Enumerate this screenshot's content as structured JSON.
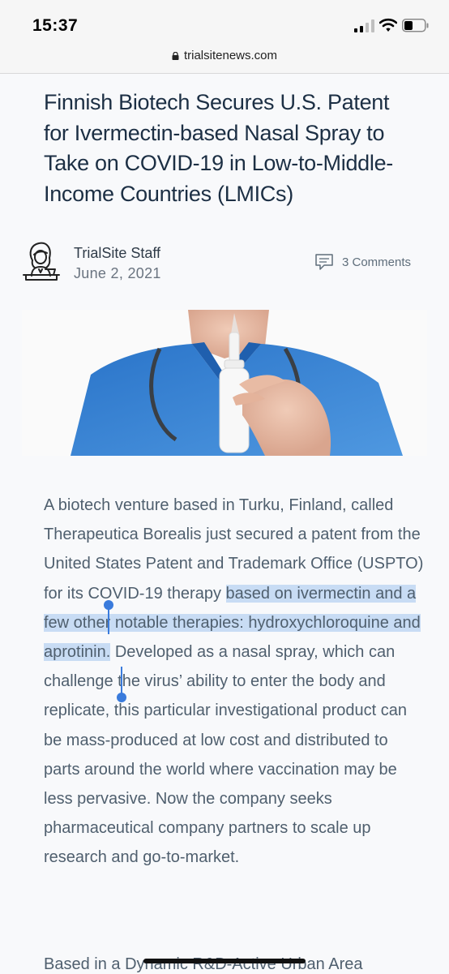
{
  "status_bar": {
    "time": "15:37"
  },
  "browser": {
    "url": "trialsitenews.com"
  },
  "article": {
    "title": "Finnish Biotech Secures U.S. Patent for Ivermectin-based Nasal Spray to Take on COVID-19 in Low-to-Middle-Income Countries (LMICs)",
    "author": "TrialSite Staff",
    "date": "June 2, 2021",
    "comments": "3 Comments",
    "paragraph1": {
      "before": "A biotech venture based in Turku, Finland, called Therapeutica Borealis just secured a patent from the United States Patent and Trademark Office (USPTO) for its COVID-19 therapy ",
      "selected": "based on ivermectin and a few other notable therapies: hydroxychloroquine and aprotinin.",
      "after": " Developed as a nasal spray, which can challenge the virus’ ability to enter the body and replicate, this particular investigational product can be mass-produced at low cost and distributed to parts around the world where vaccination may be less pervasive. Now the company seeks pharmaceutical company partners to scale up research and go-to-market."
    },
    "paragraph2_start": "Based in a Dynamic R&D-Active Urban Area"
  },
  "icons": {
    "lock": "lock-icon",
    "signal": "cellular-signal-icon",
    "wifi": "wifi-icon",
    "battery": "battery-icon",
    "comment": "comment-icon"
  },
  "colors": {
    "title": "#1c2f44",
    "body_text": "#4f5f6e",
    "selection": "#c8dcf4",
    "selection_handle": "#3a7bdc"
  }
}
